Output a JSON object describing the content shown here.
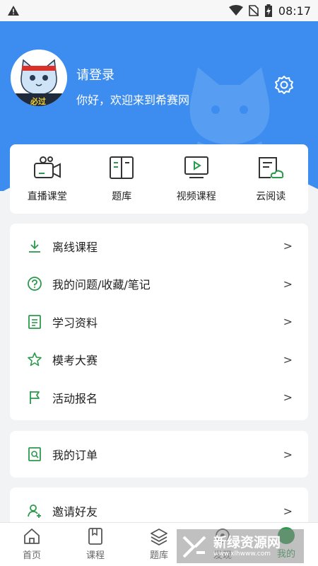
{
  "status": {
    "time": "08:17"
  },
  "profile": {
    "title": "请登录",
    "subtitle": "你好，欢迎来到希赛网",
    "badge": "必过"
  },
  "quick": [
    {
      "label": "直播课堂",
      "icon": "live-camera-icon"
    },
    {
      "label": "题库",
      "icon": "book-icon"
    },
    {
      "label": "视频课程",
      "icon": "video-icon"
    },
    {
      "label": "云阅读",
      "icon": "cloud-read-icon"
    }
  ],
  "menu": [
    {
      "label": "离线课程",
      "icon": "download-icon"
    },
    {
      "label": "我的问题/收藏/笔记",
      "icon": "question-icon"
    },
    {
      "label": "学习资料",
      "icon": "document-icon"
    },
    {
      "label": "模考大赛",
      "icon": "star-icon"
    },
    {
      "label": "活动报名",
      "icon": "flag-icon"
    }
  ],
  "order": {
    "label": "我的订单",
    "icon": "order-icon"
  },
  "invite": {
    "label": "邀请好友",
    "icon": "invite-icon"
  },
  "tabs": [
    {
      "label": "首页"
    },
    {
      "label": "课程"
    },
    {
      "label": "题库"
    },
    {
      "label": "发现"
    },
    {
      "label": "我的"
    }
  ],
  "watermark": {
    "title": "新绿资源网",
    "url": "www.xlhwww.com"
  },
  "colors": {
    "header": "#3d8df0",
    "accent": "#2b9a4c",
    "background": "#f2f3f5"
  }
}
